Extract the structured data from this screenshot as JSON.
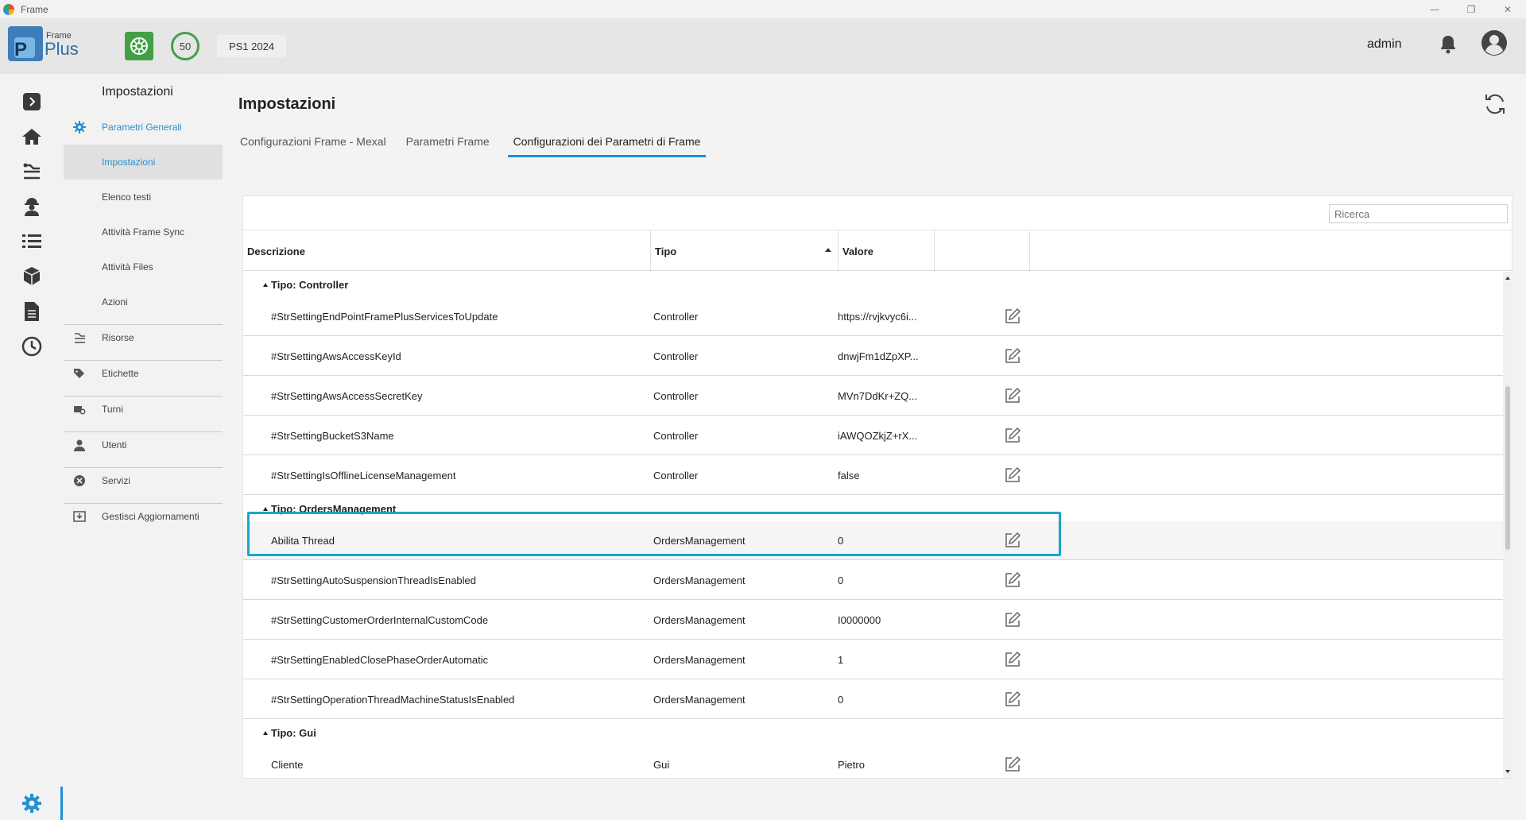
{
  "window": {
    "title": "Frame",
    "controls": [
      "—",
      "❐",
      "✕"
    ]
  },
  "header": {
    "logo_top": "Frame",
    "logo_main": "Plus",
    "logo_letter": "P",
    "circle_value": "50",
    "ps_label": "PS1 2024",
    "user": "admin"
  },
  "sidebar": {
    "heading": "Impostazioni",
    "groups": [
      {
        "label": "Parametri Generali",
        "icon": "gear-icon"
      },
      {
        "label": "Impostazioni"
      },
      {
        "label": "Elenco testi"
      },
      {
        "label": "Attività Frame Sync"
      },
      {
        "label": "Attività Files"
      },
      {
        "label": "Azioni"
      },
      {
        "label": "Risorse",
        "icon": "resources-icon"
      },
      {
        "label": "Etichette",
        "icon": "tags-icon"
      },
      {
        "label": "Turni",
        "icon": "shifts-icon"
      },
      {
        "label": "Utenti",
        "icon": "user-icon"
      },
      {
        "label": "Servizi",
        "icon": "services-icon"
      },
      {
        "label": "Gestisci Aggiornamenti",
        "icon": "download-icon"
      }
    ]
  },
  "main": {
    "title": "Impostazioni",
    "tabs": [
      {
        "label": "Configurazioni Frame - Mexal"
      },
      {
        "label": "Parametri Frame"
      },
      {
        "label": "Configurazioni dei Parametri di Frame"
      }
    ],
    "search_placeholder": "Ricerca",
    "columns": [
      "Descrizione",
      "Tipo",
      "Valore"
    ],
    "groups": [
      {
        "label": "Tipo: Controller"
      },
      {
        "label": "Tipo: OrdersManagement"
      },
      {
        "label": "Tipo: Gui"
      }
    ],
    "rows": [
      {
        "desc": "#StrSettingEndPointFramePlusServicesToUpdate",
        "type": "Controller",
        "value": "https://rvjkvyc6i..."
      },
      {
        "desc": "#StrSettingAwsAccessKeyId",
        "type": "Controller",
        "value": "dnwjFm1dZpXP..."
      },
      {
        "desc": "#StrSettingAwsAccessSecretKey",
        "type": "Controller",
        "value": "MVn7DdKr+ZQ..."
      },
      {
        "desc": "#StrSettingBucketS3Name",
        "type": "Controller",
        "value": "iAWQOZkjZ+rX..."
      },
      {
        "desc": "#StrSettingIsOfflineLicenseManagement",
        "type": "Controller",
        "value": "false"
      },
      {
        "desc": "Abilita Thread",
        "type": "OrdersManagement",
        "value": "0"
      },
      {
        "desc": "#StrSettingAutoSuspensionThreadIsEnabled",
        "type": "OrdersManagement",
        "value": "0"
      },
      {
        "desc": "#StrSettingCustomerOrderInternalCustomCode",
        "type": "OrdersManagement",
        "value": "I0000000"
      },
      {
        "desc": "#StrSettingEnabledClosePhaseOrderAutomatic",
        "type": "OrdersManagement",
        "value": "1"
      },
      {
        "desc": "#StrSettingOperationThreadMachineStatusIsEnabled",
        "type": "OrdersManagement",
        "value": "0"
      },
      {
        "desc": "Cliente",
        "type": "Gui",
        "value": "Pietro"
      }
    ]
  }
}
